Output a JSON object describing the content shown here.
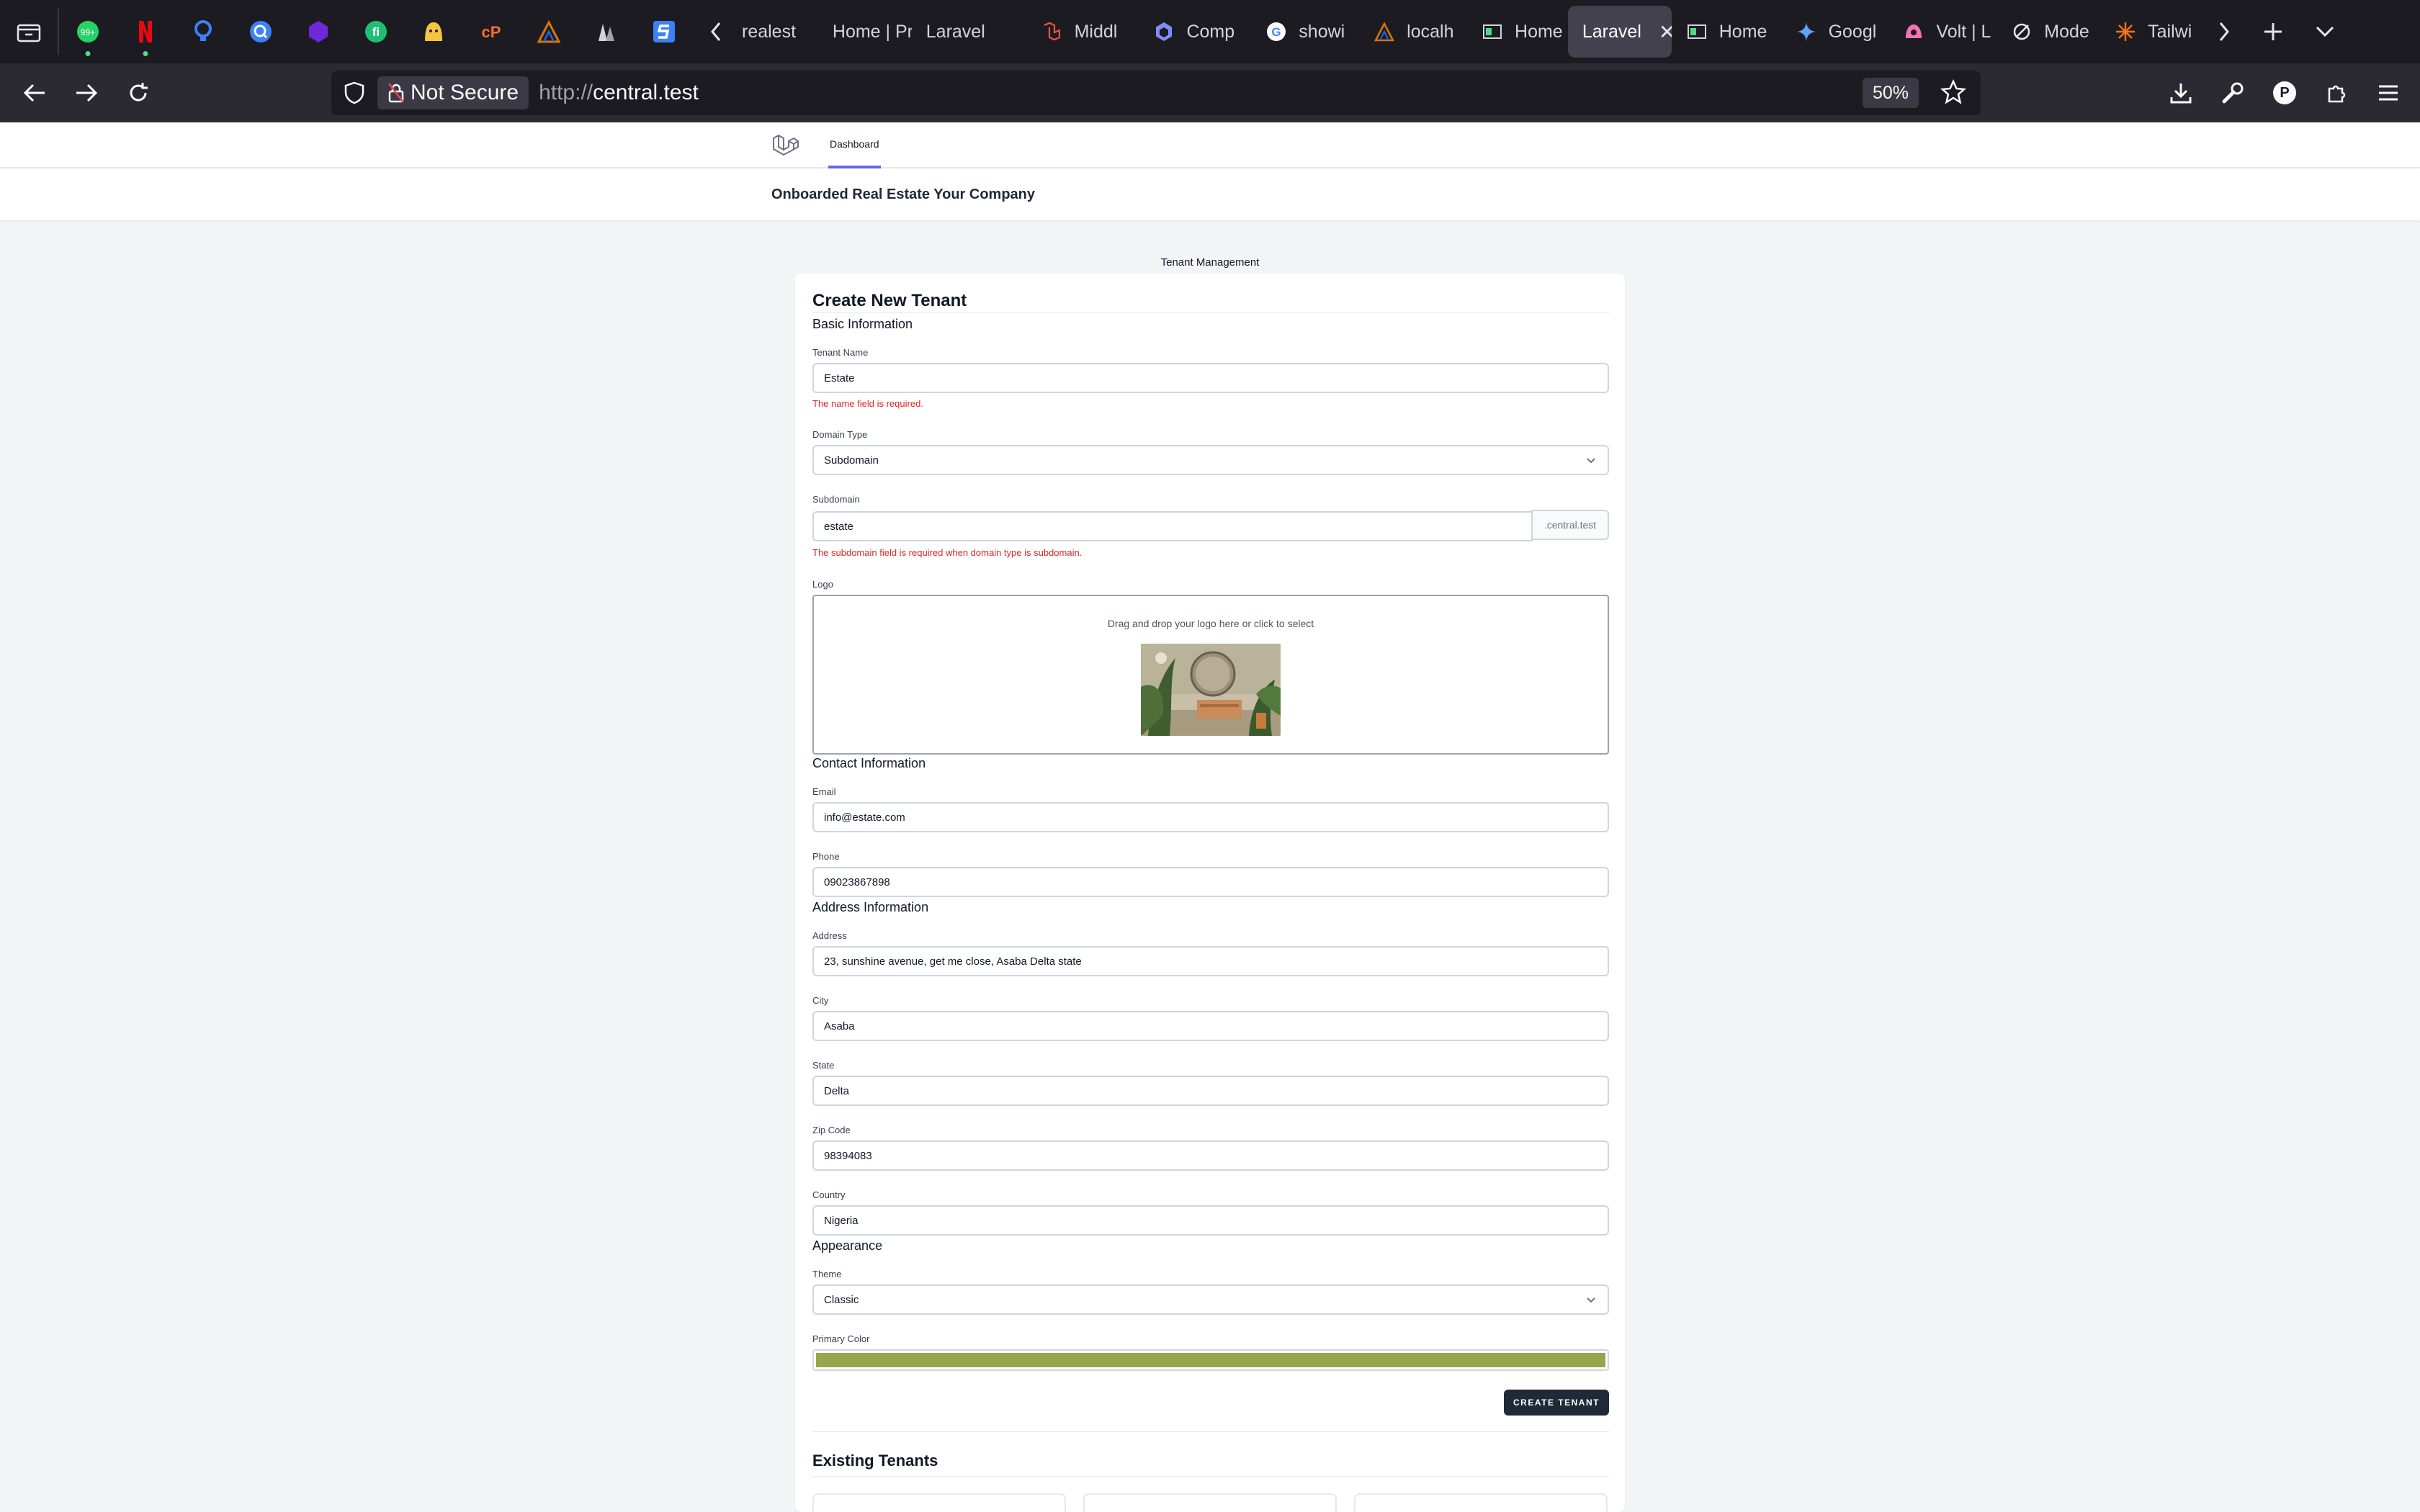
{
  "browser": {
    "pinned_tabs": [
      {
        "icon": "whatsapp-icon",
        "color": "#25d366"
      },
      {
        "icon": "netflix-icon",
        "color": "#e50914"
      },
      {
        "icon": "bulb-icon",
        "color": "#3b82f6"
      },
      {
        "icon": "search-q-icon",
        "color": "#3b82f6"
      },
      {
        "icon": "hexagon-icon",
        "color": "#6d28d9"
      },
      {
        "icon": "fiverr-icon",
        "color": "#1dbf73"
      },
      {
        "icon": "smiley-icon",
        "color": "#f5c542"
      },
      {
        "icon": "cpanel-icon",
        "color": "#ff6c2c"
      },
      {
        "icon": "laragon-icon",
        "color": "#d97706"
      },
      {
        "icon": "docs-icon",
        "color": "#9ca3af"
      },
      {
        "icon": "s-logo-icon",
        "color": "#3b82f6"
      }
    ],
    "tabs": [
      {
        "label": "realest",
        "icon": "favicon-blank"
      },
      {
        "label": "Home | Pr",
        "icon": "favicon-blank"
      },
      {
        "label": "Laravel",
        "icon": "favicon-blank"
      },
      {
        "label": "Middl",
        "icon": "laravel-icon"
      },
      {
        "label": "Comp",
        "icon": "hex-icon"
      },
      {
        "label": "showi",
        "icon": "google-icon"
      },
      {
        "label": "localh",
        "icon": "laragon-icon"
      },
      {
        "label": "Home",
        "icon": "site-icon"
      },
      {
        "label": "Laravel",
        "icon": "none",
        "active": true
      },
      {
        "label": "Home",
        "icon": "site-icon"
      },
      {
        "label": "Googl",
        "icon": "gemini-icon"
      },
      {
        "label": "Volt | L",
        "icon": "volt-icon"
      },
      {
        "label": "Mode",
        "icon": "moderne-icon"
      },
      {
        "label": "Tailwi",
        "icon": "spark-icon"
      }
    ],
    "security_label": "Not Secure",
    "url_protocol": "http://",
    "url_host": "central.test",
    "zoom": "50%"
  },
  "app": {
    "nav_link": "Dashboard",
    "header_title": "Onboarded Real Estate Your Company",
    "section_title": "Tenant Management"
  },
  "form": {
    "title": "Create New Tenant",
    "basic_heading": "Basic Information",
    "tenant_name_label": "Tenant Name",
    "tenant_name_value": "Estate",
    "tenant_name_error": "The name field is required.",
    "domain_type_label": "Domain Type",
    "domain_type_value": "Subdomain",
    "subdomain_label": "Subdomain",
    "subdomain_value": "estate",
    "subdomain_suffix": ".central.test",
    "subdomain_error": "The subdomain field is required when domain type is subdomain.",
    "logo_label": "Logo",
    "logo_dropzone_text": "Drag and drop your logo here or click to select",
    "contact_heading": "Contact Information",
    "email_label": "Email",
    "email_value": "info@estate.com",
    "phone_label": "Phone",
    "phone_value": "09023867898",
    "address_heading": "Address Information",
    "address_label": "Address",
    "address_value": "23, sunshine avenue, get me close, Asaba Delta state",
    "city_label": "City",
    "city_value": "Asaba",
    "state_label": "State",
    "state_value": "Delta",
    "zip_label": "Zip Code",
    "zip_value": "98394083",
    "country_label": "Country",
    "country_value": "Nigeria",
    "appearance_heading": "Appearance",
    "theme_label": "Theme",
    "theme_value": "Classic",
    "primary_color_label": "Primary Color",
    "primary_color_value": "#97a64a",
    "submit_label": "CREATE TENANT",
    "existing_heading": "Existing Tenants"
  },
  "colors": {
    "accent": "#6366f1",
    "error": "#dc2626",
    "button": "#1f2937"
  }
}
